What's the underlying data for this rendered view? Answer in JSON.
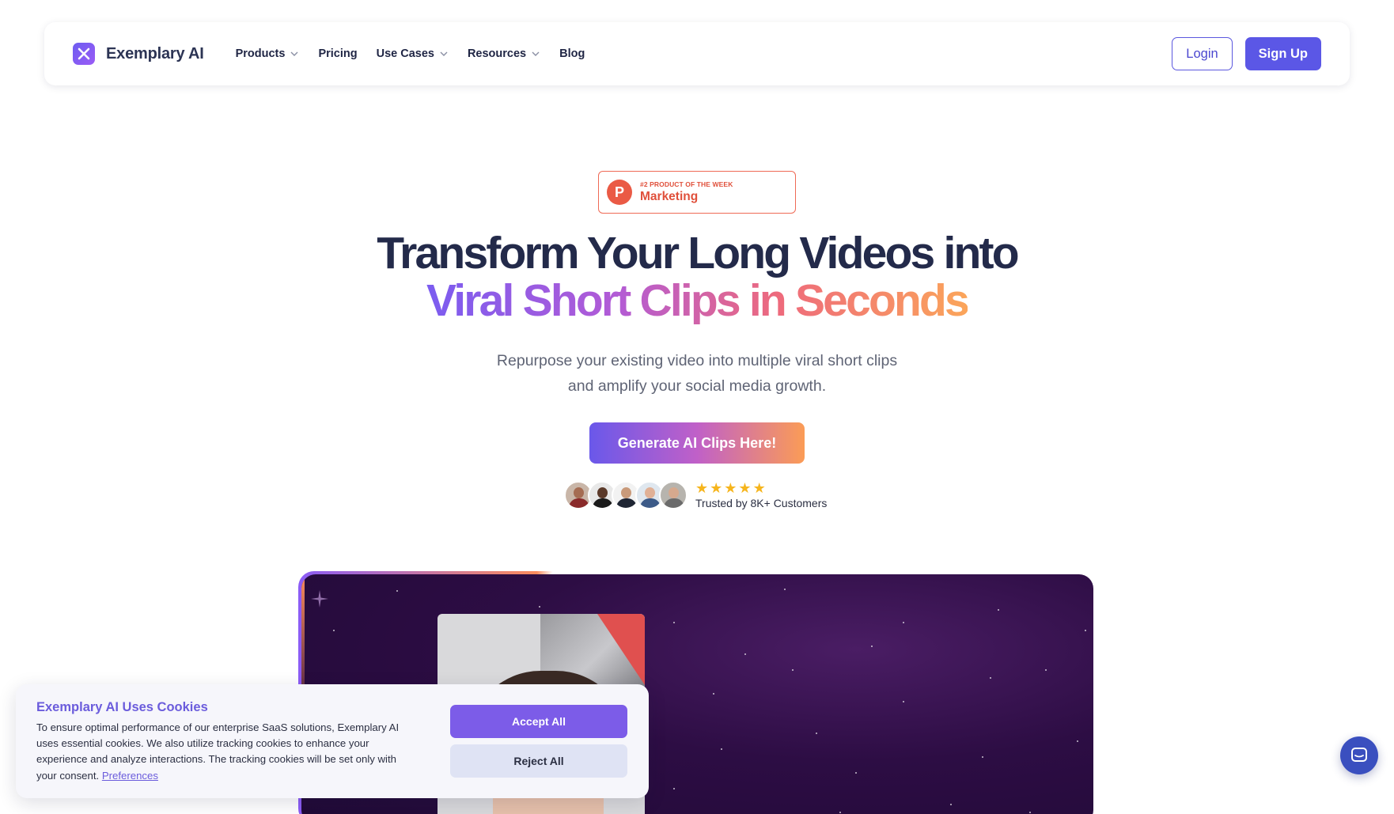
{
  "brand": {
    "name": "Exemplary AI"
  },
  "nav": {
    "items": [
      {
        "label": "Products",
        "has_dropdown": true
      },
      {
        "label": "Pricing",
        "has_dropdown": false
      },
      {
        "label": "Use Cases",
        "has_dropdown": true
      },
      {
        "label": "Resources",
        "has_dropdown": true
      },
      {
        "label": "Blog",
        "has_dropdown": false
      }
    ],
    "login_label": "Login",
    "signup_label": "Sign Up"
  },
  "badge": {
    "icon_letter": "P",
    "small_text": "#2 PRODUCT OF THE WEEK",
    "main_text": "Marketing"
  },
  "hero": {
    "title_line1": "Transform Your Long Videos into",
    "title_line2": "Viral Short Clips in Seconds",
    "subtitle_line1": "Repurpose your existing video into multiple viral short clips",
    "subtitle_line2": "and amplify your social media growth.",
    "cta_label": "Generate AI Clips Here!"
  },
  "trust": {
    "stars": 5,
    "label": "Trusted by 8K+ Customers"
  },
  "cookie": {
    "title": "Exemplary AI Uses Cookies",
    "body": "To ensure optimal performance of our enterprise SaaS solutions, Exemplary AI uses essential cookies. We also utilize tracking cookies to enhance your experience and analyze interactions. The tracking cookies will be set only with your consent.",
    "link_label": "Preferences",
    "accept_label": "Accept All",
    "reject_label": "Reject All"
  },
  "colors": {
    "accent": "#5b57e6",
    "gradient_start": "#7b5cf0",
    "gradient_end": "#fba55a",
    "badge_red": "#ea5a45",
    "star_yellow": "#f6b51d"
  },
  "icons": {
    "logo": "x-logo-icon",
    "dropdown": "chevron-down-icon",
    "chat": "chat-icon",
    "star": "star-icon"
  }
}
